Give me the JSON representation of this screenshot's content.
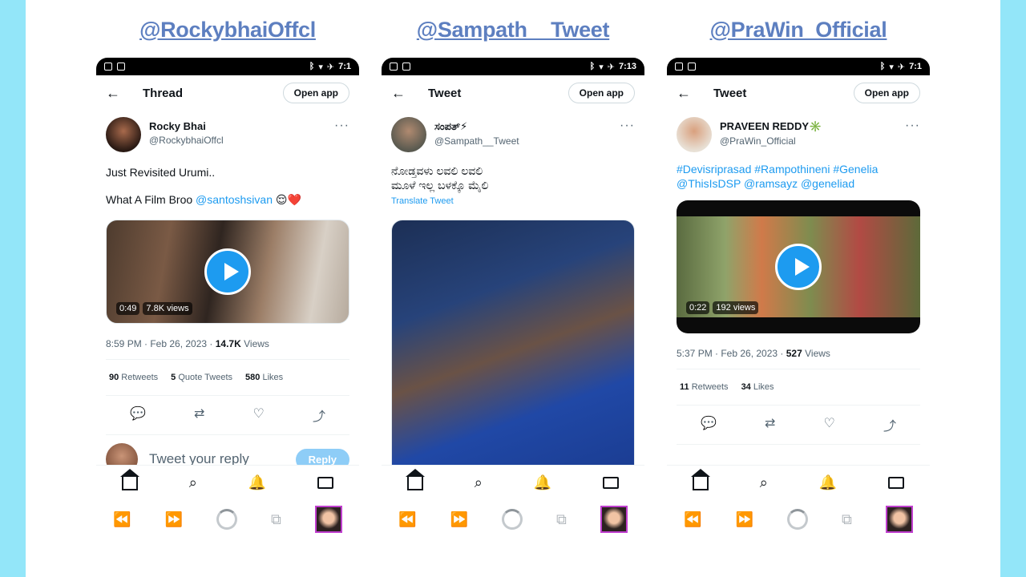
{
  "columns": [
    {
      "header": "@RockybhaiOffcl",
      "topbar_title": "Thread",
      "open_app": "Open app",
      "time": "7:1",
      "author_name": "Rocky Bhai",
      "author_handle": "@RockybhaiOffcl",
      "text_line1": "Just Revisited Urumi..",
      "text_line2": "What A Film Broo ",
      "mention": "@santoshsivan",
      "emoji": "😌❤️",
      "video_duration": "0:49",
      "video_views": "7.8K views",
      "timestamp": "8:59 PM · Feb 26, 2023 · ",
      "views_count": "14.7K",
      "views_label": " Views",
      "retweets_count": "90",
      "retweets_label": " Retweets",
      "quotes_count": "5",
      "quotes_label": " Quote Tweets",
      "likes_count": "580",
      "likes_label": " Likes",
      "reply_placeholder": "Tweet your reply",
      "reply_button": "Reply"
    },
    {
      "header": "@Sampath__Tweet",
      "topbar_title": "Tweet",
      "open_app": "Open app",
      "time": "7:13",
      "author_name": "ಸಂಪತ್⚡",
      "author_handle": "@Sampath__Tweet",
      "text_line1": "ನೋಡ್ತವಳು ಲವಲಿ ಲವಲಿ",
      "text_line2": "ಮೂಳೆ ಇಲ್ಲ ಬಳಕ್ಕೊ ಮೈಲಿ",
      "translate": "Translate Tweet"
    },
    {
      "header": "@PraWin_Official",
      "topbar_title": "Tweet",
      "open_app": "Open app",
      "time": "7:1",
      "author_name": "PRAVEEN REDDY✳️",
      "author_handle": "@PraWin_Official",
      "hashtags_line1": "#Devisriprasad #Rampothineni #Genelia",
      "hashtags_line2": "@ThisIsDSP @ramsayz @geneliad",
      "video_duration": "0:22",
      "video_views": "192 views",
      "timestamp": "5:37 PM · Feb 26, 2023 · ",
      "views_count": "527",
      "views_label": " Views",
      "retweets_count": "11",
      "retweets_label": " Retweets",
      "likes_count": "34",
      "likes_label": " Likes"
    }
  ],
  "icons": {
    "reply": "💬",
    "retweet": "⇄",
    "like": "♡",
    "share": "⤴",
    "search": "⌕",
    "bell": "🔔",
    "back": "←",
    "more": "···",
    "media_back": "⏪",
    "media_fwd": "⏩",
    "tabs": "⧉"
  },
  "colors": {
    "accent": "#1d9bf0",
    "header_link": "#5d7fc0",
    "background": "#93e6f9"
  }
}
